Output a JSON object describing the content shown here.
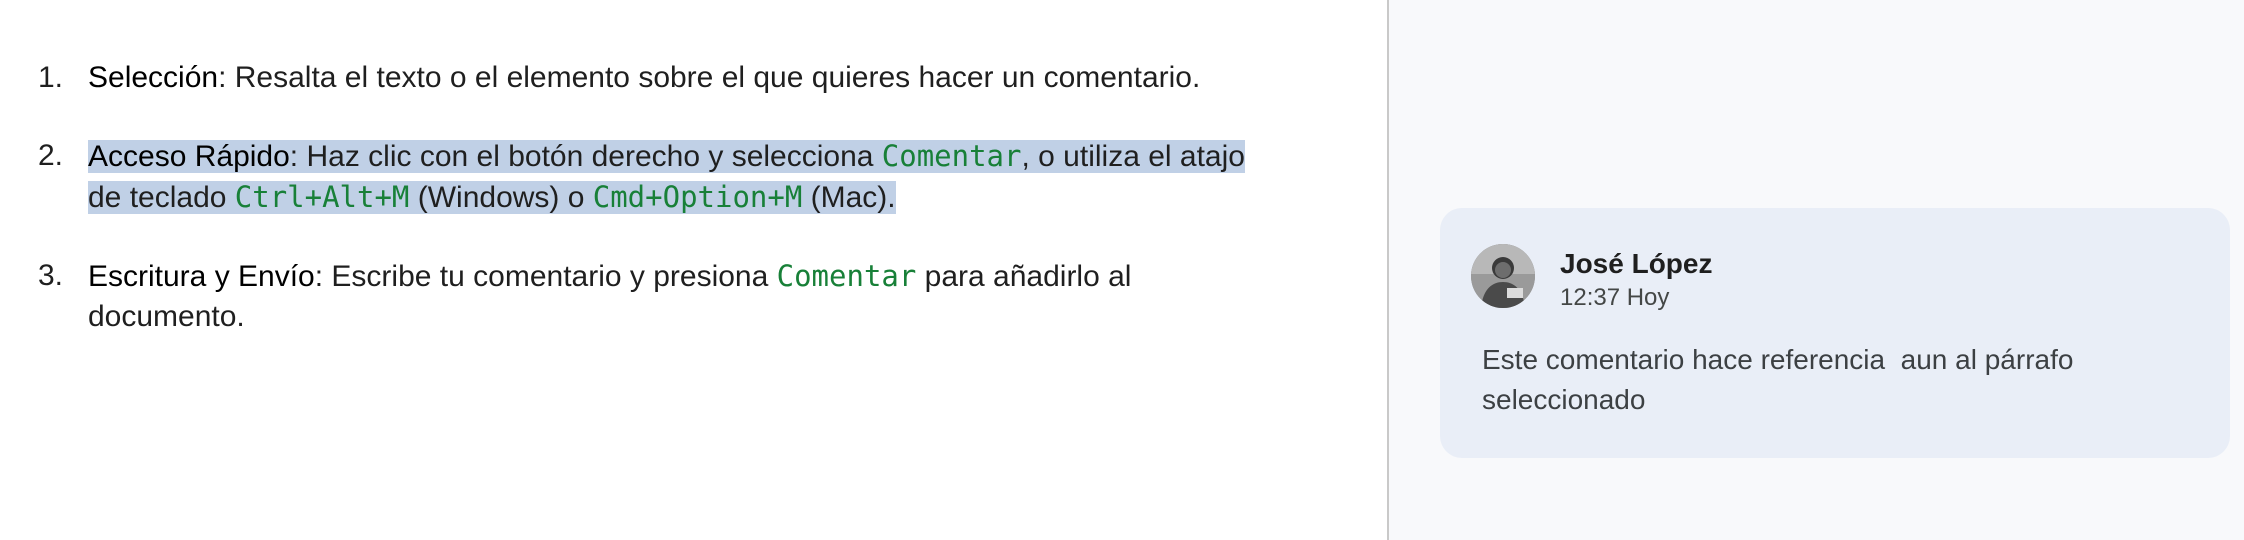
{
  "document": {
    "steps": [
      {
        "number": "1.",
        "term": "Selección",
        "text_a": ": Resalta el texto o el elemento sobre el que quieres hacer un comentario."
      },
      {
        "number": "2.",
        "term": "Acceso Rápido",
        "text_a": ": Haz clic con el botón derecho y selecciona ",
        "code_a": "Comentar",
        "text_b": ", o utiliza el atajo de teclado ",
        "code_b": "Ctrl+Alt+M",
        "text_c": " (Windows) o ",
        "code_c": "Cmd+Option+M",
        "text_d": " (Mac)."
      },
      {
        "number": "3.",
        "term": "Escritura y Envío",
        "text_a": ": Escribe tu comentario y presiona ",
        "code_a": "Comentar",
        "text_b": " para añadirlo al documento."
      }
    ],
    "highlight_color": "#c0d0e6",
    "code_color": "#188038"
  },
  "comment": {
    "author": "José López",
    "time": "12:37 Hoy",
    "text": "Este comentario hace referencia  aun al párrafo seleccionado",
    "avatar_icon": "user-photo-avatar"
  }
}
